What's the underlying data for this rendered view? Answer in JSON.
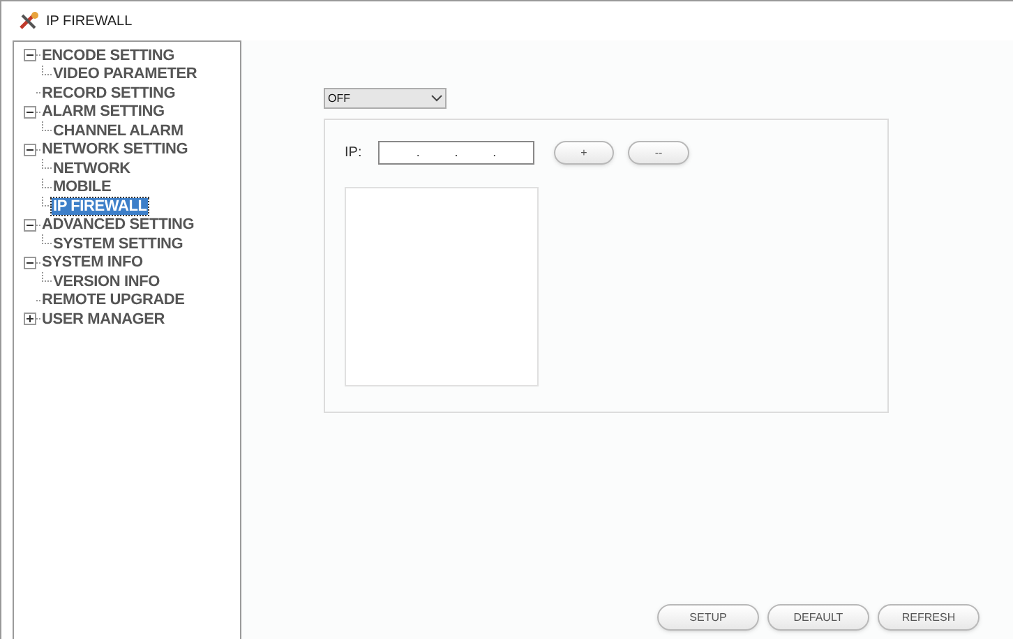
{
  "window": {
    "title": "IP FIREWALL"
  },
  "tree": [
    {
      "label": "ENCODE SETTING",
      "expanded": true,
      "selected": false,
      "children": [
        {
          "label": "VIDEO PARAMETER",
          "selected": false
        }
      ]
    },
    {
      "label": "RECORD SETTING",
      "selected": false
    },
    {
      "label": "ALARM SETTING",
      "expanded": true,
      "selected": false,
      "children": [
        {
          "label": "CHANNEL ALARM",
          "selected": false
        }
      ]
    },
    {
      "label": "NETWORK SETTING",
      "expanded": true,
      "selected": false,
      "children": [
        {
          "label": "NETWORK",
          "selected": false
        },
        {
          "label": "MOBILE",
          "selected": false
        },
        {
          "label": "IP FIREWALL",
          "selected": true
        }
      ]
    },
    {
      "label": "ADVANCED SETTING",
      "expanded": true,
      "selected": false,
      "children": [
        {
          "label": "SYSTEM SETTING",
          "selected": false
        }
      ]
    },
    {
      "label": "SYSTEM INFO",
      "expanded": true,
      "selected": false,
      "children": [
        {
          "label": "VERSION INFO",
          "selected": false
        }
      ]
    },
    {
      "label": "REMOTE UPGRADE",
      "selected": false
    },
    {
      "label": "USER MANAGER",
      "expanded": false,
      "selected": false
    }
  ],
  "firewall_mode": {
    "value": "OFF"
  },
  "ip": {
    "label": "IP:",
    "separators": [
      ".",
      ".",
      "."
    ]
  },
  "ip_buttons": [
    "+",
    "--"
  ],
  "buttons": [
    "SETUP",
    "DEFAULT",
    "REFRESH"
  ]
}
